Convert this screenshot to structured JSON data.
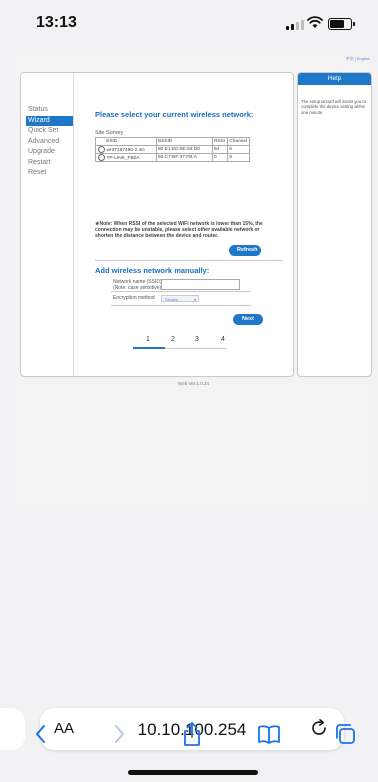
{
  "status_bar": {
    "time": "13:13"
  },
  "lang": {
    "chinese": "中文",
    "separator": " | ",
    "english": "English"
  },
  "nav": {
    "items": [
      "Status",
      "Wizard",
      "Quick Set",
      "Advanced",
      "Upgrade",
      "Restart",
      "Reset"
    ],
    "active_index": 1
  },
  "wizard": {
    "heading": "Please select your current wireless network:",
    "site_survey_title": "Site Survey",
    "table": {
      "columns": [
        "SSID",
        "BSSID",
        "RSSI",
        "Channel"
      ],
      "rows": [
        [
          "wr37197490-2.4G",
          "80:E1:ED:8E:84:D0",
          "64",
          "6"
        ],
        [
          "TP-LINK_FB0A",
          "50:C7:BF:37:FB:A",
          "0",
          "8"
        ]
      ]
    },
    "note": "★Note: When RSSI of the selected WiFi network is lower than 15%, the connection may be unstable, please select other available network or shorten the distance between the device and router.",
    "refresh_label": "Refresh",
    "add_heading": "Add wireless network manually:",
    "network_name_label": "Network name (SSID)",
    "network_name_note": "(Note: case sensitive)",
    "network_name_value": "",
    "encryption_label": "Encryption method",
    "encryption_value": "Disable",
    "next_label": "Next",
    "steps": [
      "1",
      "2",
      "3",
      "4"
    ],
    "current_step": 1
  },
  "help": {
    "title": "Help",
    "text": "The setup wizard will assist you to complete the device setting within one minute."
  },
  "footer": {
    "version": "Web Ver:1.0.24"
  },
  "safari": {
    "text_size_label": "AA",
    "url": "10.10.100.254"
  },
  "colors": {
    "accent": "#1f78c7",
    "page_bg": "#f3f3f3"
  }
}
